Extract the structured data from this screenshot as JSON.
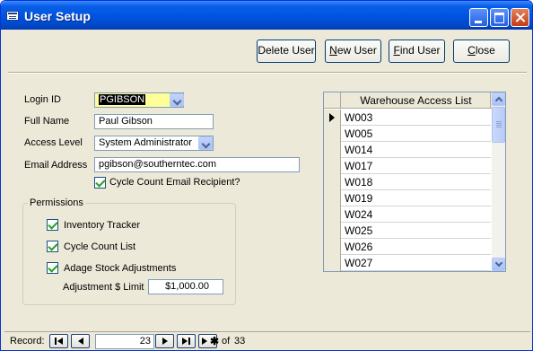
{
  "window": {
    "title": "User Setup"
  },
  "toolbar": {
    "delete_user": "Delete User",
    "new_user_pre": "",
    "new_user_u": "N",
    "new_user_post": "ew User",
    "find_user_pre": "",
    "find_user_u": "F",
    "find_user_post": "ind User",
    "close_pre": "",
    "close_u": "C",
    "close_post": "lose"
  },
  "form": {
    "login_id_label": "Login ID",
    "login_id_value": "PGIBSON",
    "full_name_label": "Full Name",
    "full_name_value": "Paul Gibson",
    "access_level_label": "Access Level",
    "access_level_value": "System Administrator",
    "email_label": "Email Address",
    "email_value": "pgibson@southerntec.com",
    "cycle_email_label": "Cycle Count Email Recipient?",
    "cycle_email_checked": true
  },
  "permissions": {
    "legend": "Permissions",
    "items": [
      {
        "label": "Inventory Tracker",
        "checked": true
      },
      {
        "label": "Cycle Count List",
        "checked": true
      },
      {
        "label": "Adage Stock Adjustments",
        "checked": true
      }
    ],
    "limit_label": "Adjustment $ Limit",
    "limit_value": "$1,000.00"
  },
  "warehouse": {
    "header": "Warehouse Access List",
    "rows": [
      "W003",
      "W005",
      "W014",
      "W017",
      "W018",
      "W019",
      "W024",
      "W025",
      "W026",
      "W027"
    ],
    "current_row": 0
  },
  "record_nav": {
    "label": "Record:",
    "current": "23",
    "of_label": "of",
    "total": "33"
  },
  "colors": {
    "titlebar": "#0054e3",
    "window_bg": "#ece9d8",
    "login_highlight": "#ffff99"
  }
}
